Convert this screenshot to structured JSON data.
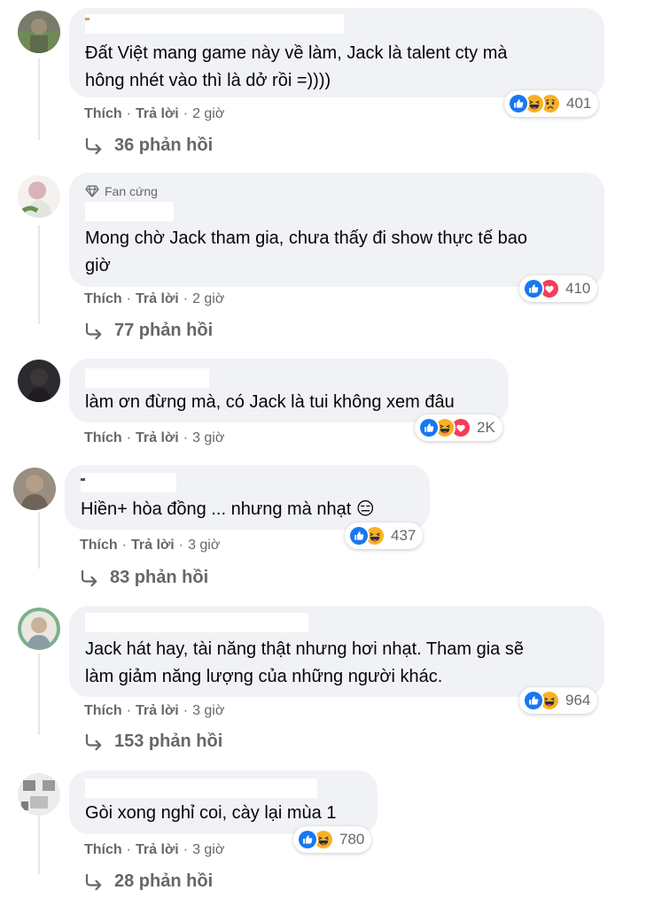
{
  "actions": {
    "like": "Thích",
    "reply": "Trả lời",
    "separator": "·"
  },
  "colors": {
    "bubble": "#f0f2f5",
    "meta": "#65676b",
    "like": "#1877f2",
    "love": "#f33e58",
    "haha": "#f7b125"
  },
  "comments": [
    {
      "text_lines": [
        "Đất Việt mang game này về làm, Jack là talent cty mà",
        "hông nhét vào thì là dở rồi =))))"
      ],
      "time": "2 giờ",
      "reactions": [
        "like",
        "haha",
        "sad"
      ],
      "reaction_count": "401",
      "replies": "36 phản hồi"
    },
    {
      "badge": "Fan cứng",
      "text_lines": [
        "Mong chờ Jack tham gia, chưa thấy đi show thực tế bao",
        "giờ"
      ],
      "time": "2 giờ",
      "reactions": [
        "like",
        "love"
      ],
      "reaction_count": "410",
      "replies": "77 phản hồi"
    },
    {
      "text_lines": [
        "làm ơn đừng mà, có Jack là tui không xem đâu"
      ],
      "time": "3 giờ",
      "reactions": [
        "like",
        "haha",
        "love"
      ],
      "reaction_count": "2K"
    },
    {
      "text_lines": [
        "Hiền+ hòa đồng ... nhưng mà nhạt 😑"
      ],
      "time": "3 giờ",
      "reactions": [
        "like",
        "haha"
      ],
      "reaction_count": "437",
      "replies": "83 phản hồi"
    },
    {
      "text_lines": [
        "Jack hát hay, tài năng thật nhưng hơi nhạt. Tham gia sẽ",
        "làm giảm năng lượng của những người khác."
      ],
      "time": "3 giờ",
      "reactions": [
        "like",
        "haha"
      ],
      "reaction_count": "964",
      "replies": "153 phản hồi"
    },
    {
      "text_lines": [
        "Gòi xong nghỉ coi, cày lại mùa 1"
      ],
      "time": "3 giờ",
      "reactions": [
        "like",
        "haha"
      ],
      "reaction_count": "780",
      "replies": "28 phản hồi"
    }
  ]
}
